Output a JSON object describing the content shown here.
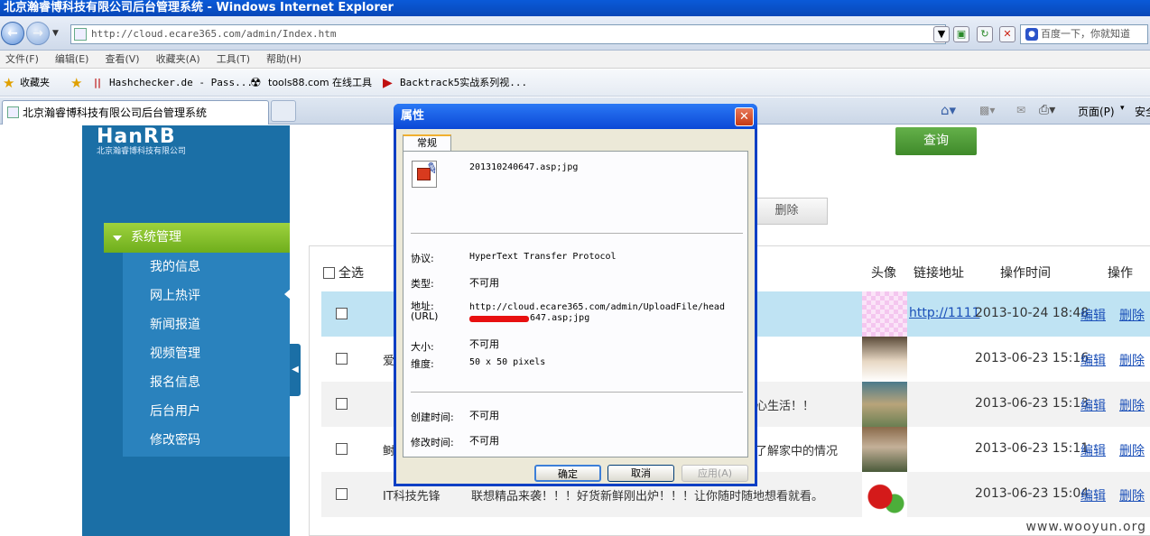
{
  "window": {
    "title": "北京瀚睿博科技有限公司后台管理系统 - Windows Internet Explorer"
  },
  "address": {
    "url": "http://cloud.ecare365.com/admin/Index.htm",
    "search_placeholder": "百度一下，你就知道"
  },
  "menu": [
    "文件(F)",
    "编辑(E)",
    "查看(V)",
    "收藏夹(A)",
    "工具(T)",
    "帮助(H)"
  ],
  "favorites": {
    "label": "收藏夹",
    "items": [
      "Hashchecker.de - Pass...",
      "tools88.com 在线工具",
      "Backtrack5实战系列视..."
    ]
  },
  "tab": {
    "title": "北京瀚睿博科技有限公司后台管理系统"
  },
  "toolbar_right": {
    "page": "页面(P)",
    "safety": "安全"
  },
  "sidebar": {
    "logo": "HanRB",
    "logo_sub": "北京瀚睿博科技有限公司",
    "section": "系统管理",
    "items": [
      "我的信息",
      "网上热评",
      "新闻报道",
      "视频管理",
      "报名信息",
      "后台用户",
      "修改密码"
    ]
  },
  "actions": {
    "search": "查询",
    "delete": "删除"
  },
  "table": {
    "headers": {
      "select_all": "全选",
      "avatar": "头像",
      "link": "链接地址",
      "time": "操作时间",
      "ops": "操作"
    },
    "edit_label": "编辑",
    "delete_label": "删除",
    "rows": [
      {
        "text": "",
        "link": "http://1111",
        "date": "2013-10-24 18:48"
      },
      {
        "text": "爱",
        "link": "",
        "date": "2013-06-23 15:16"
      },
      {
        "text": "安心生活！！",
        "link": "",
        "date": "2013-06-23 15:13"
      },
      {
        "text": "鲥",
        "text2": "可了解家中的情况",
        "link": "",
        "date": "2013-06-23 15:11"
      },
      {
        "text": "IT科技先锋",
        "text2": "联想精品来袭！！！好货新鲜刚出炉！！！让你随时随地想看就看。",
        "link": "",
        "date": "2013-06-23 15:04"
      }
    ]
  },
  "dialog": {
    "title": "属性",
    "tab": "常规",
    "filename": "201310240647.asp;jpg",
    "protocol_label": "协议:",
    "protocol": "HyperText Transfer Protocol",
    "type_label": "类型:",
    "type": "不可用",
    "address_label": "地址:",
    "address_label2": "(URL)",
    "address_line1": "http://cloud.ecare365.com/admin/UploadFile/head",
    "address_line2": "647.asp;jpg",
    "size_label": "大小:",
    "size": "不可用",
    "dim_label": "维度:",
    "dimensions": "50  x  50  pixels",
    "created_label": "创建时间:",
    "created": "不可用",
    "modified_label": "修改时间:",
    "modified": "不可用",
    "ok": "确定",
    "cancel": "取消",
    "apply": "应用(A)"
  },
  "watermark": "www.wooyun.org"
}
